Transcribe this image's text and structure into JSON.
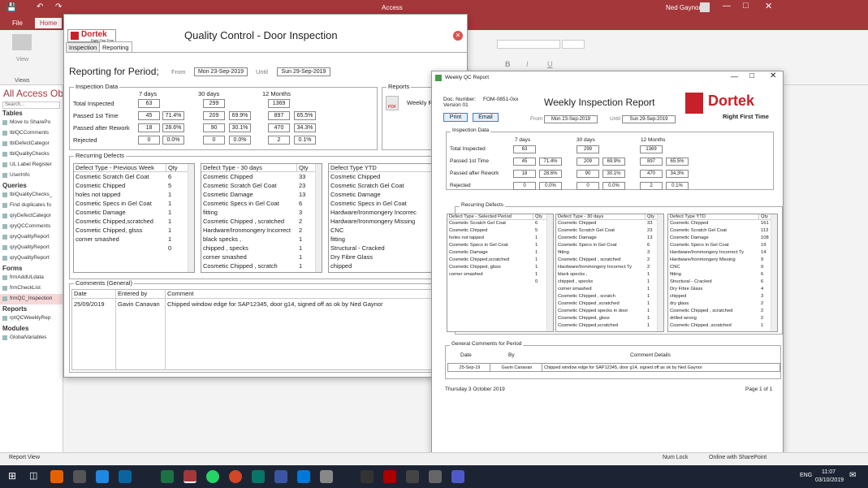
{
  "access": {
    "title": "Access",
    "user": "Ned Gaynor",
    "tabs": [
      "File",
      "Home"
    ],
    "ribbon_buttons": [
      "View",
      "Views"
    ],
    "nav_title": "All Access Ob",
    "nav_search": "Search...",
    "nav_sections": [
      {
        "name": "Tables",
        "items": [
          "Move to SharePo",
          "tblQCComments",
          "tblDefectCategor",
          "tblQualityChecks",
          "UL Label Register",
          "UserInfo"
        ]
      },
      {
        "name": "Queries",
        "items": [
          "tblQualityChecks_",
          "Find duplicates fo",
          "qryDefectCategor",
          "qryQCComments",
          "qryQualityReport",
          "qryQualityReport",
          "qryQualityReport"
        ]
      },
      {
        "name": "Forms",
        "items": [
          "frmAddULdata",
          "frmCheckList",
          "frmQC_Inspection"
        ]
      },
      {
        "name": "Reports",
        "items": [
          "rptQCWeeklyRep"
        ]
      },
      {
        "name": "Modules",
        "items": [
          "GlobalVariables"
        ]
      }
    ],
    "status_left": "Report View",
    "status_numlock": "Num Lock",
    "status_sharepoint": "Online with SharePoint"
  },
  "taskbar": {
    "lang": "ENG",
    "time": "11:07",
    "date": "03/10/2019"
  },
  "qc": {
    "logo": "Dortek",
    "logo_sub": "Right First Time",
    "title": "Quality Control - Door Inspection",
    "tabs": [
      "Inspection",
      "Reporting"
    ],
    "period_label": "Reporting for Period;",
    "from_label": "From",
    "from": "Mon 23-Sep-2019",
    "until_label": "Until",
    "until": "Sun 29-Sep-2019",
    "inspection_legend": "Inspection Data",
    "reports_legend": "Reports",
    "reports_item": "Weekly R",
    "col_heads": [
      "7 days",
      "30 days",
      "12 Months"
    ],
    "rows": [
      {
        "label": "Total Inspected",
        "v": [
          "63",
          "",
          "299",
          "",
          "1369",
          ""
        ]
      },
      {
        "label": "Passed 1st Time",
        "v": [
          "45",
          "71.4%",
          "209",
          "69.9%",
          "897",
          "65.5%"
        ]
      },
      {
        "label": "Passed after Rework",
        "v": [
          "18",
          "28.6%",
          "90",
          "30.1%",
          "470",
          "34.3%"
        ]
      },
      {
        "label": "Rejected",
        "v": [
          "0",
          "0.0%",
          "0",
          "0.0%",
          "2",
          "0.1%"
        ]
      }
    ],
    "recurring_legend": "Recurring Defects",
    "list1_head": [
      "Defect Type - Previous Week",
      "Qty"
    ],
    "list1": [
      [
        "Cosmetic Scratch Gel Coat",
        "6"
      ],
      [
        "Cosmetic Chipped",
        "5"
      ],
      [
        "holes not tapped",
        "1"
      ],
      [
        "Cosmetic Specs in Gel Coat",
        "1"
      ],
      [
        "Cosmetic Damage",
        "1"
      ],
      [
        "Cosmetic Chipped,scratched",
        "1"
      ],
      [
        "Cosmetic Chipped, glsss",
        "1"
      ],
      [
        "corner smashed",
        "1"
      ],
      [
        "",
        "0"
      ]
    ],
    "list2_head": [
      "Defect Type - 30 days",
      "Qty"
    ],
    "list2": [
      [
        "Cosmetic Chipped",
        "33"
      ],
      [
        "Cosmetic Scratch Gel Coat",
        "23"
      ],
      [
        "Cosmetic Damage",
        "13"
      ],
      [
        "Cosmetic Specs in Gel Coat",
        "6"
      ],
      [
        "fitting",
        "3"
      ],
      [
        "Cosmetic Chipped , scratched",
        "2"
      ],
      [
        "Hardware/Ironmongery Incorrect",
        "2"
      ],
      [
        "black specks ,",
        "1"
      ],
      [
        "chipped , specks",
        "1"
      ],
      [
        "corner smashed",
        "1"
      ],
      [
        "Cosmetic Chipped , scratch",
        "1"
      ]
    ],
    "list3_head": [
      "Defect Type YTD",
      "Q"
    ],
    "list3": [
      [
        "Cosmetic Chipped",
        "16"
      ],
      [
        "Cosmetic Scratch Gel Coat",
        "11"
      ],
      [
        "Cosmetic Damage",
        "10"
      ],
      [
        "Cosmetic Specs in Gel Coat",
        "19"
      ],
      [
        "Hardware/Ironmongery Incorrec",
        "14"
      ],
      [
        "Hardware/Ironmongery Missing",
        "9"
      ],
      [
        "CNC",
        "9"
      ],
      [
        "fitting",
        "6"
      ],
      [
        "Structural - Cracked",
        "6"
      ],
      [
        "Dry Fibre Glass",
        "4"
      ],
      [
        "chipped",
        "3"
      ]
    ],
    "comments_legend": "Comments (General)",
    "comments_head": [
      "Date",
      "Entered by",
      "Comment"
    ],
    "comments": [
      [
        "25/09/2019",
        "Gavin Canavan",
        "Chipped window edge for SAP12345, door g14, signed off as ok by Ned Gaynor"
      ]
    ]
  },
  "report": {
    "window_title": "Weekly QC Report",
    "doc_number_label": "Doc. Number:",
    "doc_number": "FOM-0851-0xx",
    "version": "Version 01",
    "title": "Weekly Inspection Report",
    "logo": "Dortek",
    "logo_tag": "Right First Time",
    "print": "Print",
    "email": "Email",
    "from_label": "From",
    "from": "Mon 23-Sep-2019",
    "until_label": "Until",
    "until": "Sun 29-Sep-2019",
    "inspection_legend": "Inspection Data",
    "col_heads": [
      "7 days",
      "30 days",
      "12 Months"
    ],
    "rows": [
      {
        "label": "Total Inspected",
        "v": [
          "63",
          "",
          "299",
          "",
          "1369",
          ""
        ]
      },
      {
        "label": "Passed 1st Time",
        "v": [
          "45",
          "71.4%",
          "209",
          "69.9%",
          "897",
          "65.5%"
        ]
      },
      {
        "label": "Passed after Rework",
        "v": [
          "18",
          "28.6%",
          "90",
          "30.1%",
          "470",
          "34.3%"
        ]
      },
      {
        "label": "Rejected",
        "v": [
          "0",
          "0.0%",
          "0",
          "0.0%",
          "2",
          "0.1%"
        ]
      }
    ],
    "recurring_legend": "Recurring Defects",
    "list1_head": [
      "Defect Type - Selected Period",
      "Qty"
    ],
    "list1": [
      [
        "Cosmetic Scratch Gel Coat",
        "6"
      ],
      [
        "Cosmetic Chipped",
        "5"
      ],
      [
        "holes not tapped",
        "1"
      ],
      [
        "Cosmetic Specs in Gel Coat",
        "1"
      ],
      [
        "Cosmetic Damage",
        "1"
      ],
      [
        "Cosmetic Chipped,scratched",
        "1"
      ],
      [
        "Cosmetic Chipped, glsss",
        "1"
      ],
      [
        "corner smashed",
        "1"
      ],
      [
        "",
        "0"
      ]
    ],
    "list2_head": [
      "Defect Type - 30 days",
      "Qty"
    ],
    "list2": [
      [
        "Cosmetic Chipped",
        "33"
      ],
      [
        "Cosmetic Scratch Gel Coat",
        "23"
      ],
      [
        "Cosmetic Damage",
        "13"
      ],
      [
        "Cosmetic Specs in Gel Coat",
        "6"
      ],
      [
        "fitting",
        "3"
      ],
      [
        "Cosmetic Chipped , scratched",
        "2"
      ],
      [
        "Hardware/Ironmongery Incorrect Ty",
        "2"
      ],
      [
        "black specks ,",
        "1"
      ],
      [
        "chipped , specks",
        "1"
      ],
      [
        "corner smashed",
        "1"
      ],
      [
        "Cosmetic Chipped , scratch",
        "1"
      ],
      [
        "Cosmetic Chipped ,scratched",
        "1"
      ],
      [
        "Cosmetic Chipped specks in door",
        "1"
      ],
      [
        "Cosmetic Chipped, glsss",
        "1"
      ],
      [
        "Cosmetic Chipped,scratched",
        "1"
      ]
    ],
    "list3_head": [
      "Defect Type YTD",
      "Qty"
    ],
    "list3": [
      [
        "Cosmetic Chipped",
        "161"
      ],
      [
        "Cosmetic Scratch Gel Coat",
        "113"
      ],
      [
        "Cosmetic Damage",
        "108"
      ],
      [
        "Cosmetic Specs in Gel Coat",
        "19"
      ],
      [
        "Hardware/Ironmongery Incorrect Ty",
        "14"
      ],
      [
        "Hardware/Ironmongery Missing",
        "9"
      ],
      [
        "CNC",
        "9"
      ],
      [
        "fitting",
        "6"
      ],
      [
        "Structural - Cracked",
        "6"
      ],
      [
        "Dry Fibre Glass",
        "4"
      ],
      [
        "chipped",
        "3"
      ],
      [
        "dry glass",
        "2"
      ],
      [
        "Cosmetic Chipped , scratched",
        "2"
      ],
      [
        "drilled wrong",
        "2"
      ],
      [
        "Cosmetic Chipped ,scratched",
        "1"
      ]
    ],
    "comments_legend": "General Comments for Period",
    "comments_head": [
      "Date",
      "By",
      "Comment Details"
    ],
    "comments": [
      [
        "25-Sep-19",
        "Gavin Canavan",
        "Chipped window edge for SAP12345, door g14, signed off as ok by Ned Gaynor"
      ]
    ],
    "footer_date": "Thursday 3 October 2019",
    "footer_page": "Page 1 of 1"
  }
}
